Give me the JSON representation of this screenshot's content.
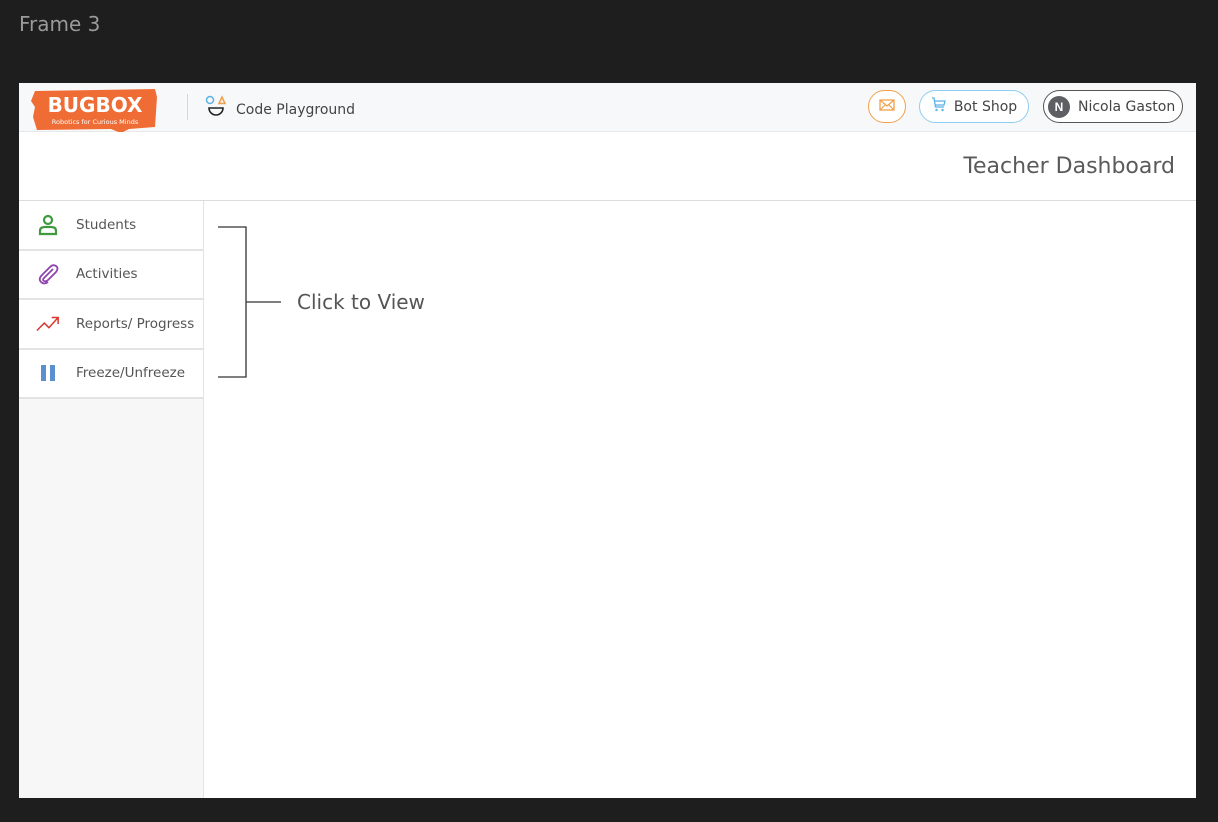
{
  "frame_label": "Frame 3",
  "topbar": {
    "logo": {
      "title": "BUGBOX",
      "tagline": "Robotics for Curious Minds",
      "color": "#ef6c35"
    },
    "app_link": {
      "label": "Code Playground",
      "icon": "shapes-face-icon"
    },
    "mail_button": {
      "icon": "mail-icon",
      "color": "#f0a04b"
    },
    "shop_button": {
      "label": "Bot Shop",
      "icon": "cart-icon",
      "color": "#8ecdf2"
    },
    "user_button": {
      "initial": "N",
      "name": "Nicola Gaston"
    }
  },
  "header": {
    "title": "Teacher Dashboard"
  },
  "sidebar": {
    "items": [
      {
        "label": "Students",
        "icon": "person-icon",
        "color": "#3f9a3f"
      },
      {
        "label": "Activities",
        "icon": "paperclip-icon",
        "color": "#8e44ad"
      },
      {
        "label": "Reports/ Progress",
        "icon": "trending-up-icon",
        "color": "#d9342b"
      },
      {
        "label": "Freeze/Unfreeze",
        "icon": "pause-icon",
        "color": "#5b8fd0"
      }
    ]
  },
  "annotation": {
    "label": "Click to View"
  }
}
